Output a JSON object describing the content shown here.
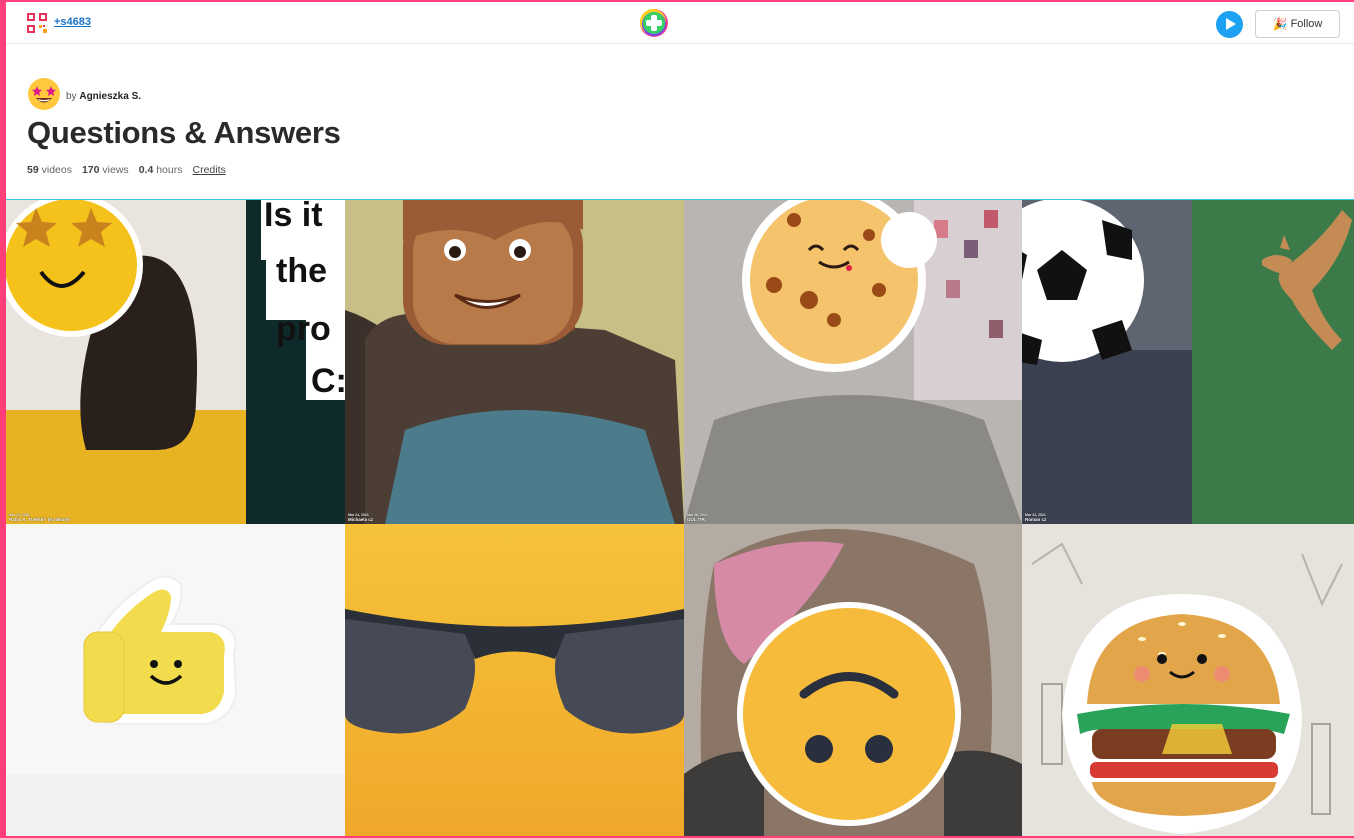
{
  "header": {
    "code_link": "+s4683",
    "follow_label": "Follow"
  },
  "board": {
    "by_prefix": "by",
    "author": "Agnieszka S.",
    "title": "Questions & Answers",
    "videos_count": "59",
    "videos_label": "videos",
    "views_count": "170",
    "views_label": "views",
    "hours_count": "0.4",
    "hours_label": "hours",
    "credits_label": "Credits"
  },
  "tiles": [
    {
      "name": "Rabia A. TURKEY (Kırıkkale)",
      "date": "Mar 21, 2021"
    },
    {
      "name": "Michaela cz",
      "date": "Mar 24, 2021"
    },
    {
      "name": "GÜL /TR",
      "date": "Mar 26, 2021"
    },
    {
      "name": "Roman cz",
      "date": "Mar 24, 2021"
    },
    {
      "name": "",
      "date": ""
    },
    {
      "name": "",
      "date": ""
    },
    {
      "name": "",
      "date": ""
    },
    {
      "name": "",
      "date": ""
    }
  ],
  "overlay_text": {
    "line1": "Is it",
    "line2": "the",
    "line3": "pro",
    "line4": "C:"
  },
  "colors": {
    "accent_border": "#ff3e7a",
    "link": "#1a73c7",
    "play": "#1da1f2"
  },
  "icons": [
    "qr-code-icon",
    "app-logo-icon",
    "play-icon",
    "party-icon",
    "avatar-emoji-icon"
  ]
}
